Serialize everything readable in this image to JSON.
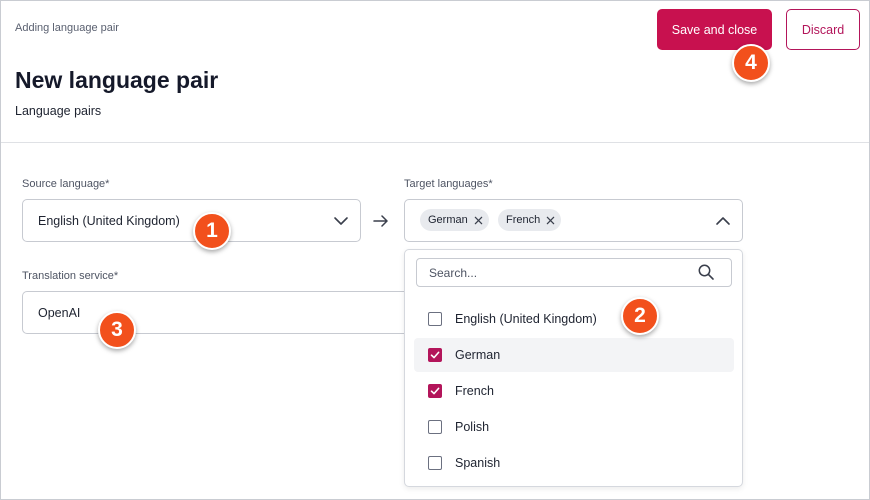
{
  "header": {
    "eyebrow": "Adding language pair",
    "title": "New language pair",
    "subtitle": "Language pairs"
  },
  "actions": {
    "save_label": "Save and close",
    "discard_label": "Discard"
  },
  "form": {
    "source_label": "Source language*",
    "source_value": "English (United Kingdom)",
    "target_label": "Target languages*",
    "target_chips": [
      "German",
      "French"
    ],
    "service_label": "Translation service*",
    "service_value": "OpenAI"
  },
  "dropdown": {
    "search_placeholder": "Search...",
    "options": [
      {
        "label": "English (United Kingdom)",
        "checked": false
      },
      {
        "label": "German",
        "checked": true
      },
      {
        "label": "French",
        "checked": true
      },
      {
        "label": "Polish",
        "checked": false
      },
      {
        "label": "Spanish",
        "checked": false
      }
    ]
  },
  "callouts": [
    "1",
    "2",
    "3",
    "4"
  ],
  "colors": {
    "primary": "#c8114f",
    "accent": "#b3155a",
    "callout": "#f2501c"
  },
  "icons": {
    "source_chevron": "chevron-down-icon",
    "target_chevron": "chevron-up-icon",
    "arrow": "arrow-right-icon",
    "chip_remove": "close-icon",
    "search": "search-icon",
    "check": "check-icon"
  }
}
